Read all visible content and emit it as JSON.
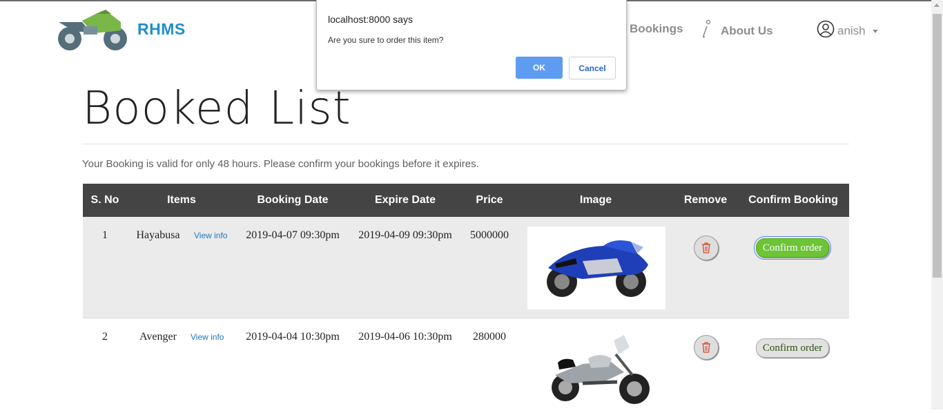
{
  "navbar": {
    "brand": "RHMS",
    "bookings_label": "Bookings",
    "about_label": "About Us",
    "user_name": "anish"
  },
  "page": {
    "title": "Booked List",
    "notice": "Your Booking is valid for only 48 hours. Please confirm your bookings before it expires."
  },
  "table": {
    "headers": [
      "S. No",
      "Items",
      "Booking Date",
      "Expire Date",
      "Price",
      "Image",
      "Remove",
      "Confirm Booking"
    ],
    "rows": [
      {
        "sno": "1",
        "item": "Hayabusa",
        "view_info": "View info",
        "booking_date": "2019-04-07 09:30pm",
        "expire_date": "2019-04-09 09:30pm",
        "price": "5000000",
        "image": "blue-sport-motorcycle",
        "confirm_label": "Confirm order"
      },
      {
        "sno": "2",
        "item": "Avenger",
        "view_info": "View info",
        "booking_date": "2019-04-04 10:30pm",
        "expire_date": "2019-04-06 10:30pm",
        "price": "280000",
        "image": "silver-cruiser-motorcycle",
        "confirm_label": "Confirm order"
      }
    ]
  },
  "dialog": {
    "title": "localhost:8000 says",
    "message": "Are you sure to order this item?",
    "ok_label": "OK",
    "cancel_label": "Cancel"
  },
  "colors": {
    "brand": "#1e8fc9",
    "table_header_bg": "#444444",
    "confirm_active": "#6cc436",
    "ok_button": "#5d9cf0"
  }
}
